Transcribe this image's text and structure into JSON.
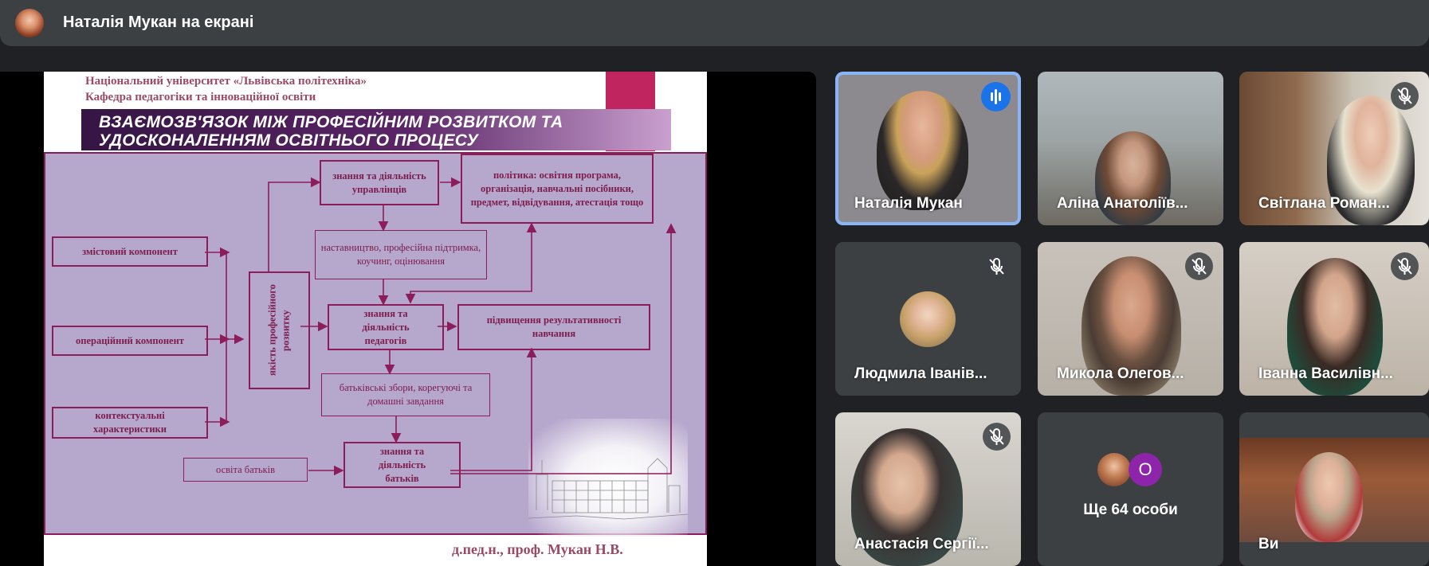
{
  "header": {
    "title": "Наталія Мукан на екрані"
  },
  "slide": {
    "university": "Національний університет «Львівська політехніка»",
    "department": "Кафедра педагогіки та інноваційної освіти",
    "title_line1": "ВЗАЄМОЗВ'ЯЗОК МІЖ ПРОФЕСІЙНИМ РОЗВИТКОМ ТА",
    "title_line2": "УДОСКОНАЛЕННЯМ ОСВІТНЬОГО ПРОЦЕСУ",
    "boxes": {
      "content": "змістовий компонент",
      "operational": "операційний компонент",
      "contextual": "контекстуальні характеристики",
      "quality": "якість професійного розвитку",
      "managers": "знання та діяльність управлінців",
      "policy": "політика: освітня програма, організація, навчальні посібники, предмет, відвідування, атестація тощо",
      "mentoring": "наставництво, професійна підтримка, коучинг, оцінювання",
      "teachers": "знання та діяльність педагогів",
      "results": "підвищення результативності навчання",
      "parent_meetings": "батьківські збори, корегуючі та домашні завдання",
      "parents_edu": "освіта батьків",
      "parents": "знання та діяльність батьків"
    },
    "footer": "д.пед.н., проф. Мукан Н.В."
  },
  "participants": [
    {
      "name": "Наталія Мукан",
      "state": "speaking"
    },
    {
      "name": "Аліна Анатоліїв...",
      "state": "video"
    },
    {
      "name": "Світлана Роман...",
      "state": "muted"
    },
    {
      "name": "Людмила Іванів...",
      "state": "muted"
    },
    {
      "name": "Микола Олегов...",
      "state": "muted"
    },
    {
      "name": "Іванна Василівн...",
      "state": "muted"
    },
    {
      "name": "Анастасія Сергії...",
      "state": "muted"
    },
    {
      "name": "Ви",
      "state": "self"
    }
  ],
  "more": {
    "count_label": "Ще 64 особи",
    "avatar_letter": "О"
  },
  "colors": {
    "speaking_accent": "#1a73e8",
    "active_border": "#8ab4f8",
    "slide_accent": "#8c1c5a",
    "more_avatar": "#8e24aa"
  }
}
